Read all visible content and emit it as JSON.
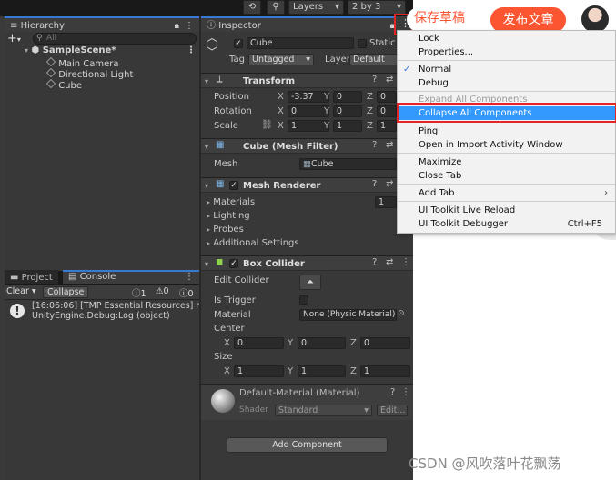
{
  "toolbar": {
    "history_icon": "history-icon",
    "search_icon": "search-icon",
    "layers_label": "Layers",
    "layout_label": "2 by 3"
  },
  "hierarchy": {
    "tab_label": "Hierarchy",
    "add_label": "+",
    "search_placeholder": "All",
    "scene": "SampleScene*",
    "items": [
      {
        "label": "Main Camera"
      },
      {
        "label": "Directional Light"
      },
      {
        "label": "Cube"
      }
    ]
  },
  "bottom_tabs": {
    "project_label": "Project",
    "console_label": "Console"
  },
  "console": {
    "clear_label": "Clear",
    "collapse_label": "Collapse",
    "count_info": "1",
    "count_warn": "0",
    "count_error": "0",
    "log_line1": "[16:06:06] [TMP Essential Resources] hav",
    "log_line2": "UnityEngine.Debug:Log (object)"
  },
  "inspector": {
    "tab_label": "Inspector",
    "object_name": "Cube",
    "static_label": "Static",
    "tag_label": "Tag",
    "tag_value": "Untagged",
    "layer_label": "Layer",
    "layer_value": "Default",
    "transform": {
      "title": "Transform",
      "position_label": "Position",
      "rotation_label": "Rotation",
      "scale_label": "Scale",
      "position": {
        "x": "-3.37",
        "y": "0",
        "z": "0"
      },
      "rotation": {
        "x": "0",
        "y": "0",
        "z": "0"
      },
      "scale": {
        "x": "1",
        "y": "1",
        "z": "1"
      }
    },
    "mesh_filter": {
      "title": "Cube (Mesh Filter)",
      "mesh_label": "Mesh",
      "mesh_value": "Cube"
    },
    "mesh_renderer": {
      "title": "Mesh Renderer",
      "materials_label": "Materials",
      "materials_count": "1",
      "lighting_label": "Lighting",
      "probes_label": "Probes",
      "additional_label": "Additional Settings"
    },
    "box_collider": {
      "title": "Box Collider",
      "edit_label": "Edit Collider",
      "trigger_label": "Is Trigger",
      "material_label": "Material",
      "material_value": "None (Physic Material)",
      "center_label": "Center",
      "center": {
        "x": "0",
        "y": "0",
        "z": "0"
      },
      "size_label": "Size",
      "size": {
        "x": "1",
        "y": "1",
        "z": "1"
      }
    },
    "material": {
      "name": "Default-Material (Material)",
      "shader_label": "Shader",
      "shader_value": "Standard",
      "edit_label": "Edit..."
    },
    "add_component_label": "Add Component",
    "axis_x": "X",
    "axis_y": "Y",
    "axis_z": "Z"
  },
  "context_menu": {
    "items": [
      {
        "label": "Lock"
      },
      {
        "label": "Properties..."
      },
      {
        "label": "Normal"
      },
      {
        "label": "Debug"
      },
      {
        "label": "Expand All Components"
      },
      {
        "label": "Collapse All Components"
      },
      {
        "label": "Ping"
      },
      {
        "label": "Open in Import Activity Window"
      },
      {
        "label": "Maximize"
      },
      {
        "label": "Close Tab"
      },
      {
        "label": "Add Tab"
      },
      {
        "label": "UI Toolkit Live Reload"
      },
      {
        "label": "UI Toolkit Debugger"
      }
    ],
    "shortcut_debugger": "Ctrl+F5",
    "checkmark": "✓",
    "submenu_arrow": "›"
  },
  "web": {
    "save_draft_label": "保存草稿",
    "publish_label": "发布文章",
    "watermark": "CSDN @风吹落叶花飘荡"
  },
  "colors": {
    "highlight": "#3399ff",
    "annotation_red": "#e42525",
    "csdn_orange": "#fc5531"
  }
}
